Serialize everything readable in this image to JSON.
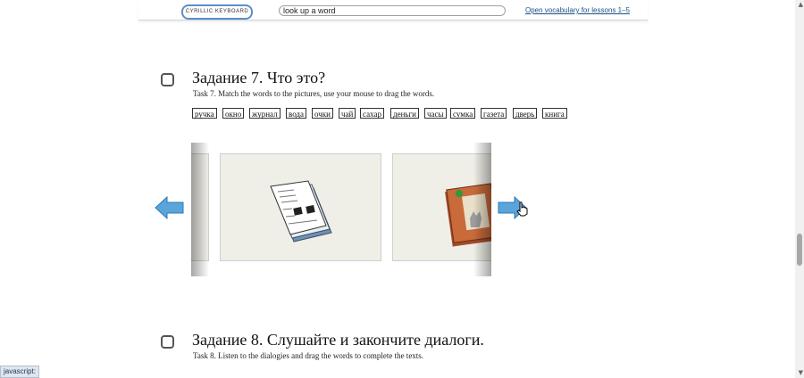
{
  "toolbar": {
    "keyboard_label": "CYRILLIC KEYBOARD",
    "search_value": "look up a word",
    "vocab_link": "Open vocabulary for lessons 1–5"
  },
  "task7": {
    "title": "Задание 7. Что это?",
    "description": "Task 7. Match the words to the pictures, use your mouse to drag the words.",
    "words": [
      "ручка",
      "окно",
      "журнал",
      "вода",
      "очки",
      "чай",
      "сахар",
      "деньги",
      "часы",
      "сумка",
      "газета",
      "дверь",
      "книга"
    ]
  },
  "carousel": {
    "slides": [
      "newspaper-picture",
      "magazine-picture"
    ]
  },
  "task8": {
    "title": "Задание 8. Слушайте и закончите диалоги.",
    "description": "Task 8. Listen to the dialogies and drag the words to complete the texts."
  },
  "status": {
    "text": "javascript:"
  },
  "colors": {
    "arrow": "#5aa4dc",
    "link": "#1a4f8a",
    "keyboard_border": "#5b8fc7"
  }
}
